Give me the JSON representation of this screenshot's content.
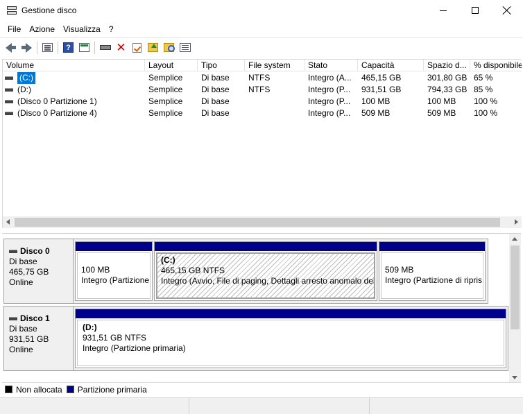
{
  "window": {
    "title": "Gestione disco",
    "icon": "disk-management-icon"
  },
  "menu": [
    "File",
    "Azione",
    "Visualizza",
    "?"
  ],
  "toolbar": {
    "icons": [
      "back-icon",
      "forward-icon",
      "list-view-icon",
      "help-icon",
      "console-panel-icon",
      "drive-icon",
      "delete-icon",
      "check-icon",
      "folder-up-icon",
      "search-icon",
      "properties-icon"
    ]
  },
  "volume_list": {
    "columns": [
      "Volume",
      "Layout",
      "Tipo",
      "File system",
      "Stato",
      "Capacità",
      "Spazio d...",
      "% disponibile"
    ],
    "rows": [
      {
        "volume": "(C:)",
        "layout": "Semplice",
        "tipo": "Di base",
        "fs": "NTFS",
        "stato": "Integro (A...",
        "capacita": "465,15 GB",
        "spazio": "301,80 GB",
        "perc": "65 %",
        "selected": true
      },
      {
        "volume": "(D:)",
        "layout": "Semplice",
        "tipo": "Di base",
        "fs": "NTFS",
        "stato": "Integro (P...",
        "capacita": "931,51 GB",
        "spazio": "794,33 GB",
        "perc": "85 %",
        "selected": false
      },
      {
        "volume": "(Disco 0 Partizione 1)",
        "layout": "Semplice",
        "tipo": "Di base",
        "fs": "",
        "stato": "Integro (P...",
        "capacita": "100 MB",
        "spazio": "100 MB",
        "perc": "100 %",
        "selected": false
      },
      {
        "volume": "(Disco 0 Partizione 4)",
        "layout": "Semplice",
        "tipo": "Di base",
        "fs": "",
        "stato": "Integro (P...",
        "capacita": "509 MB",
        "spazio": "509 MB",
        "perc": "100 %",
        "selected": false
      }
    ]
  },
  "disks": [
    {
      "name": "Disco 0",
      "type": "Di base",
      "size": "465,75 GB",
      "status": "Online",
      "partitions": [
        {
          "title": "",
          "line1": "100 MB",
          "line2": "Integro (Partizione"
        },
        {
          "title": "(C:)",
          "line1": "465,15 GB NTFS",
          "line2": "Integro (Avvio, File di paging, Dettagli arresto anomalo del"
        },
        {
          "title": "",
          "line1": "509 MB",
          "line2": "Integro (Partizione di ripris"
        }
      ]
    },
    {
      "name": "Disco 1",
      "type": "Di base",
      "size": "931,51 GB",
      "status": "Online",
      "partitions": [
        {
          "title": "(D:)",
          "line1": "931,51 GB NTFS",
          "line2": "Integro (Partizione primaria)"
        }
      ]
    }
  ],
  "legend": [
    {
      "label": "Non allocata",
      "color": "#000000"
    },
    {
      "label": "Partizione primaria",
      "color": "#00008b"
    }
  ]
}
